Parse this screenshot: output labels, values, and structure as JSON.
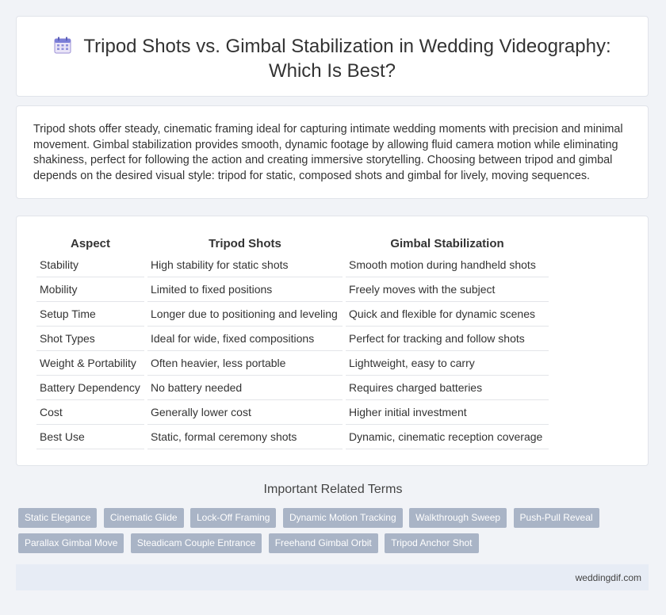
{
  "header": {
    "title_line1": "Tripod Shots vs. Gimbal Stabilization in Wedding Videography:",
    "title_line2": "Which Is Best?",
    "icon": "calendar-icon"
  },
  "intro": {
    "text": "Tripod shots offer steady, cinematic framing ideal for capturing intimate wedding moments with precision and minimal movement. Gimbal stabilization provides smooth, dynamic footage by allowing fluid camera motion while eliminating shakiness, perfect for following the action and creating immersive storytelling. Choosing between tripod and gimbal depends on the desired visual style: tripod for static, composed shots and gimbal for lively, moving sequences."
  },
  "table": {
    "headers": [
      "Aspect",
      "Tripod Shots",
      "Gimbal Stabilization"
    ],
    "rows": [
      [
        "Stability",
        "High stability for static shots",
        "Smooth motion during handheld shots"
      ],
      [
        "Mobility",
        "Limited to fixed positions",
        "Freely moves with the subject"
      ],
      [
        "Setup Time",
        "Longer due to positioning and leveling",
        "Quick and flexible for dynamic scenes"
      ],
      [
        "Shot Types",
        "Ideal for wide, fixed compositions",
        "Perfect for tracking and follow shots"
      ],
      [
        "Weight & Portability",
        "Often heavier, less portable",
        "Lightweight, easy to carry"
      ],
      [
        "Battery Dependency",
        "No battery needed",
        "Requires charged batteries"
      ],
      [
        "Cost",
        "Generally lower cost",
        "Higher initial investment"
      ],
      [
        "Best Use",
        "Static, formal ceremony shots",
        "Dynamic, cinematic reception coverage"
      ]
    ]
  },
  "related": {
    "title": "Important Related Terms",
    "tags": [
      "Static Elegance",
      "Cinematic Glide",
      "Lock-Off Framing",
      "Dynamic Motion Tracking",
      "Walkthrough Sweep",
      "Push-Pull Reveal",
      "Parallax Gimbal Move",
      "Steadicam Couple Entrance",
      "Freehand Gimbal Orbit",
      "Tripod Anchor Shot"
    ]
  },
  "footer": {
    "site": "weddingdif.com"
  }
}
